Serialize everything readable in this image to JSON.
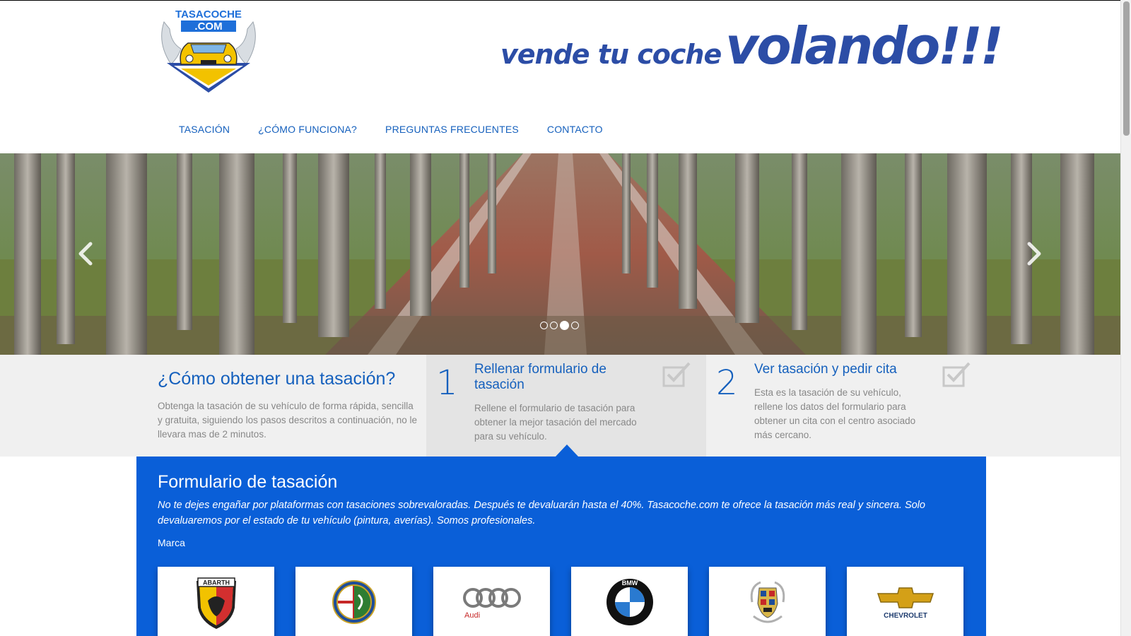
{
  "header": {
    "logo_text_top": "TASACOCHE",
    "logo_text_bottom": ".COM",
    "slogan_small": "vende tu coche",
    "slogan_big": "volando!!!"
  },
  "nav": {
    "items": [
      {
        "label": "TASACIÓN"
      },
      {
        "label": "¿CÓMO FUNCIONA?"
      },
      {
        "label": "PREGUNTAS FRECUENTES"
      },
      {
        "label": "CONTACTO"
      }
    ]
  },
  "carousel": {
    "slide_count": 4,
    "active_index": 3
  },
  "steps": {
    "intro_title": "¿Cómo obtener una tasación?",
    "intro_text": "Obtenga la tasación de su vehículo de forma rápida, sencilla y gratuita, siguiendo los pasos descritos a continuación, no le llevara mas de 2 minutos.",
    "items": [
      {
        "number": "1",
        "title": "Rellenar formulario de tasación",
        "text": "Rellene el formulario de tasación para obtener la mejor tasación del mercado para su vehículo."
      },
      {
        "number": "2",
        "title": "Ver tasación y pedir cita",
        "text": "Esta es la tasación de su vehículo, rellene los datos del formulario para obtener un cita con el centro asociado más cercano."
      }
    ]
  },
  "form": {
    "title": "Formulario de tasación",
    "description": "No te dejes engañar por plataformas con tasaciones sobrevaloradas. Después te devaluarán hasta el 40%. Tasacoche.com te ofrece la tasación más real y sincera. Solo devaluaremos por el estado de tu vehículo (pintura, averías). Somos profesionales.",
    "brand_label": "Marca",
    "brands": [
      {
        "name": "ABARTH"
      },
      {
        "name": "ALFA ROMEO"
      },
      {
        "name": "Audi"
      },
      {
        "name": "BMW"
      },
      {
        "name": "Cadillac"
      },
      {
        "name": "CHEVROLET"
      }
    ]
  },
  "colors": {
    "brand_blue": "#1560bd",
    "form_blue": "#0a5fd8",
    "slogan_blue": "#2c4da6"
  }
}
